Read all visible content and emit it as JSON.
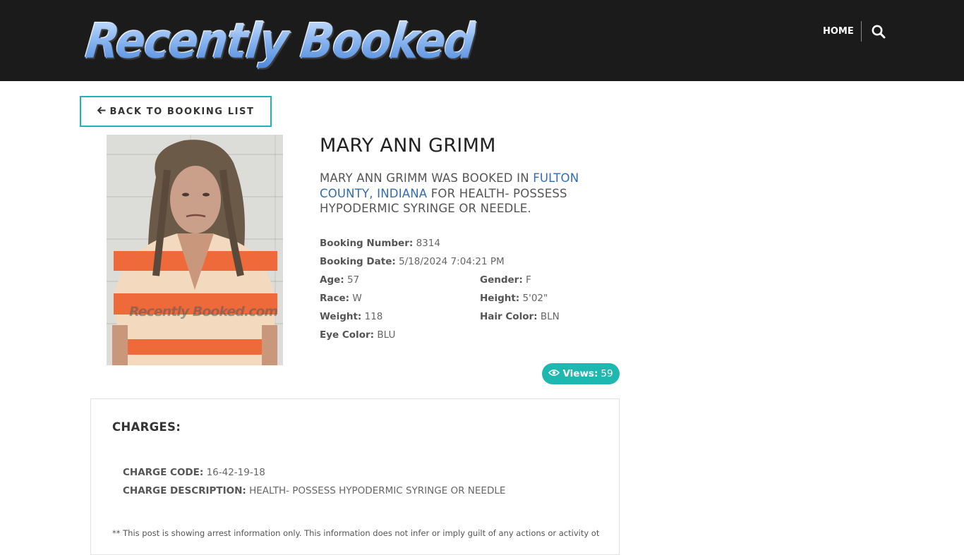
{
  "header": {
    "logo_text": "Recently Booked",
    "nav_home": "HOME",
    "search_icon": "search-icon"
  },
  "back_button": {
    "label": "BACK TO BOOKING LIST",
    "icon": "arrow-left-icon"
  },
  "mugshot": {
    "watermark": "Recently Booked.com"
  },
  "person": {
    "name": "MARY ANN GRIMM",
    "summary_prefix": "MARY ANN GRIMM WAS BOOKED IN ",
    "summary_link": "FULTON COUNTY, INDIANA",
    "summary_suffix": " FOR HEALTH- POSSESS HYPODERMIC SYRINGE OR NEEDLE."
  },
  "details": {
    "booking_number_label": "Booking Number:",
    "booking_number": "8314",
    "booking_date_label": "Booking Date:",
    "booking_date": "5/18/2024 7:04:21 PM",
    "age_label": "Age:",
    "age": "57",
    "gender_label": "Gender:",
    "gender": "F",
    "race_label": "Race:",
    "race": "W",
    "height_label": "Height:",
    "height": "5'02\"",
    "weight_label": "Weight:",
    "weight": "118",
    "hair_label": "Hair Color:",
    "hair": "BLN",
    "eye_label": "Eye Color:",
    "eye": "BLU"
  },
  "views": {
    "icon": "eye-icon",
    "label": "Views:",
    "count": "59"
  },
  "charges": {
    "title": "CHARGES:",
    "code_label": "CHARGE CODE:",
    "code": "16-42-19-18",
    "desc_label": "CHARGE DESCRIPTION:",
    "desc": "HEALTH- POSSESS HYPODERMIC SYRINGE OR NEEDLE",
    "disclaimer": "** This post is showing arrest information only. This information does not infer or imply guilt of any actions or activity other"
  },
  "colors": {
    "header_bg": "#1b1b1b",
    "accent_teal": "#1fb8b0",
    "link_blue": "#2f6db5"
  }
}
